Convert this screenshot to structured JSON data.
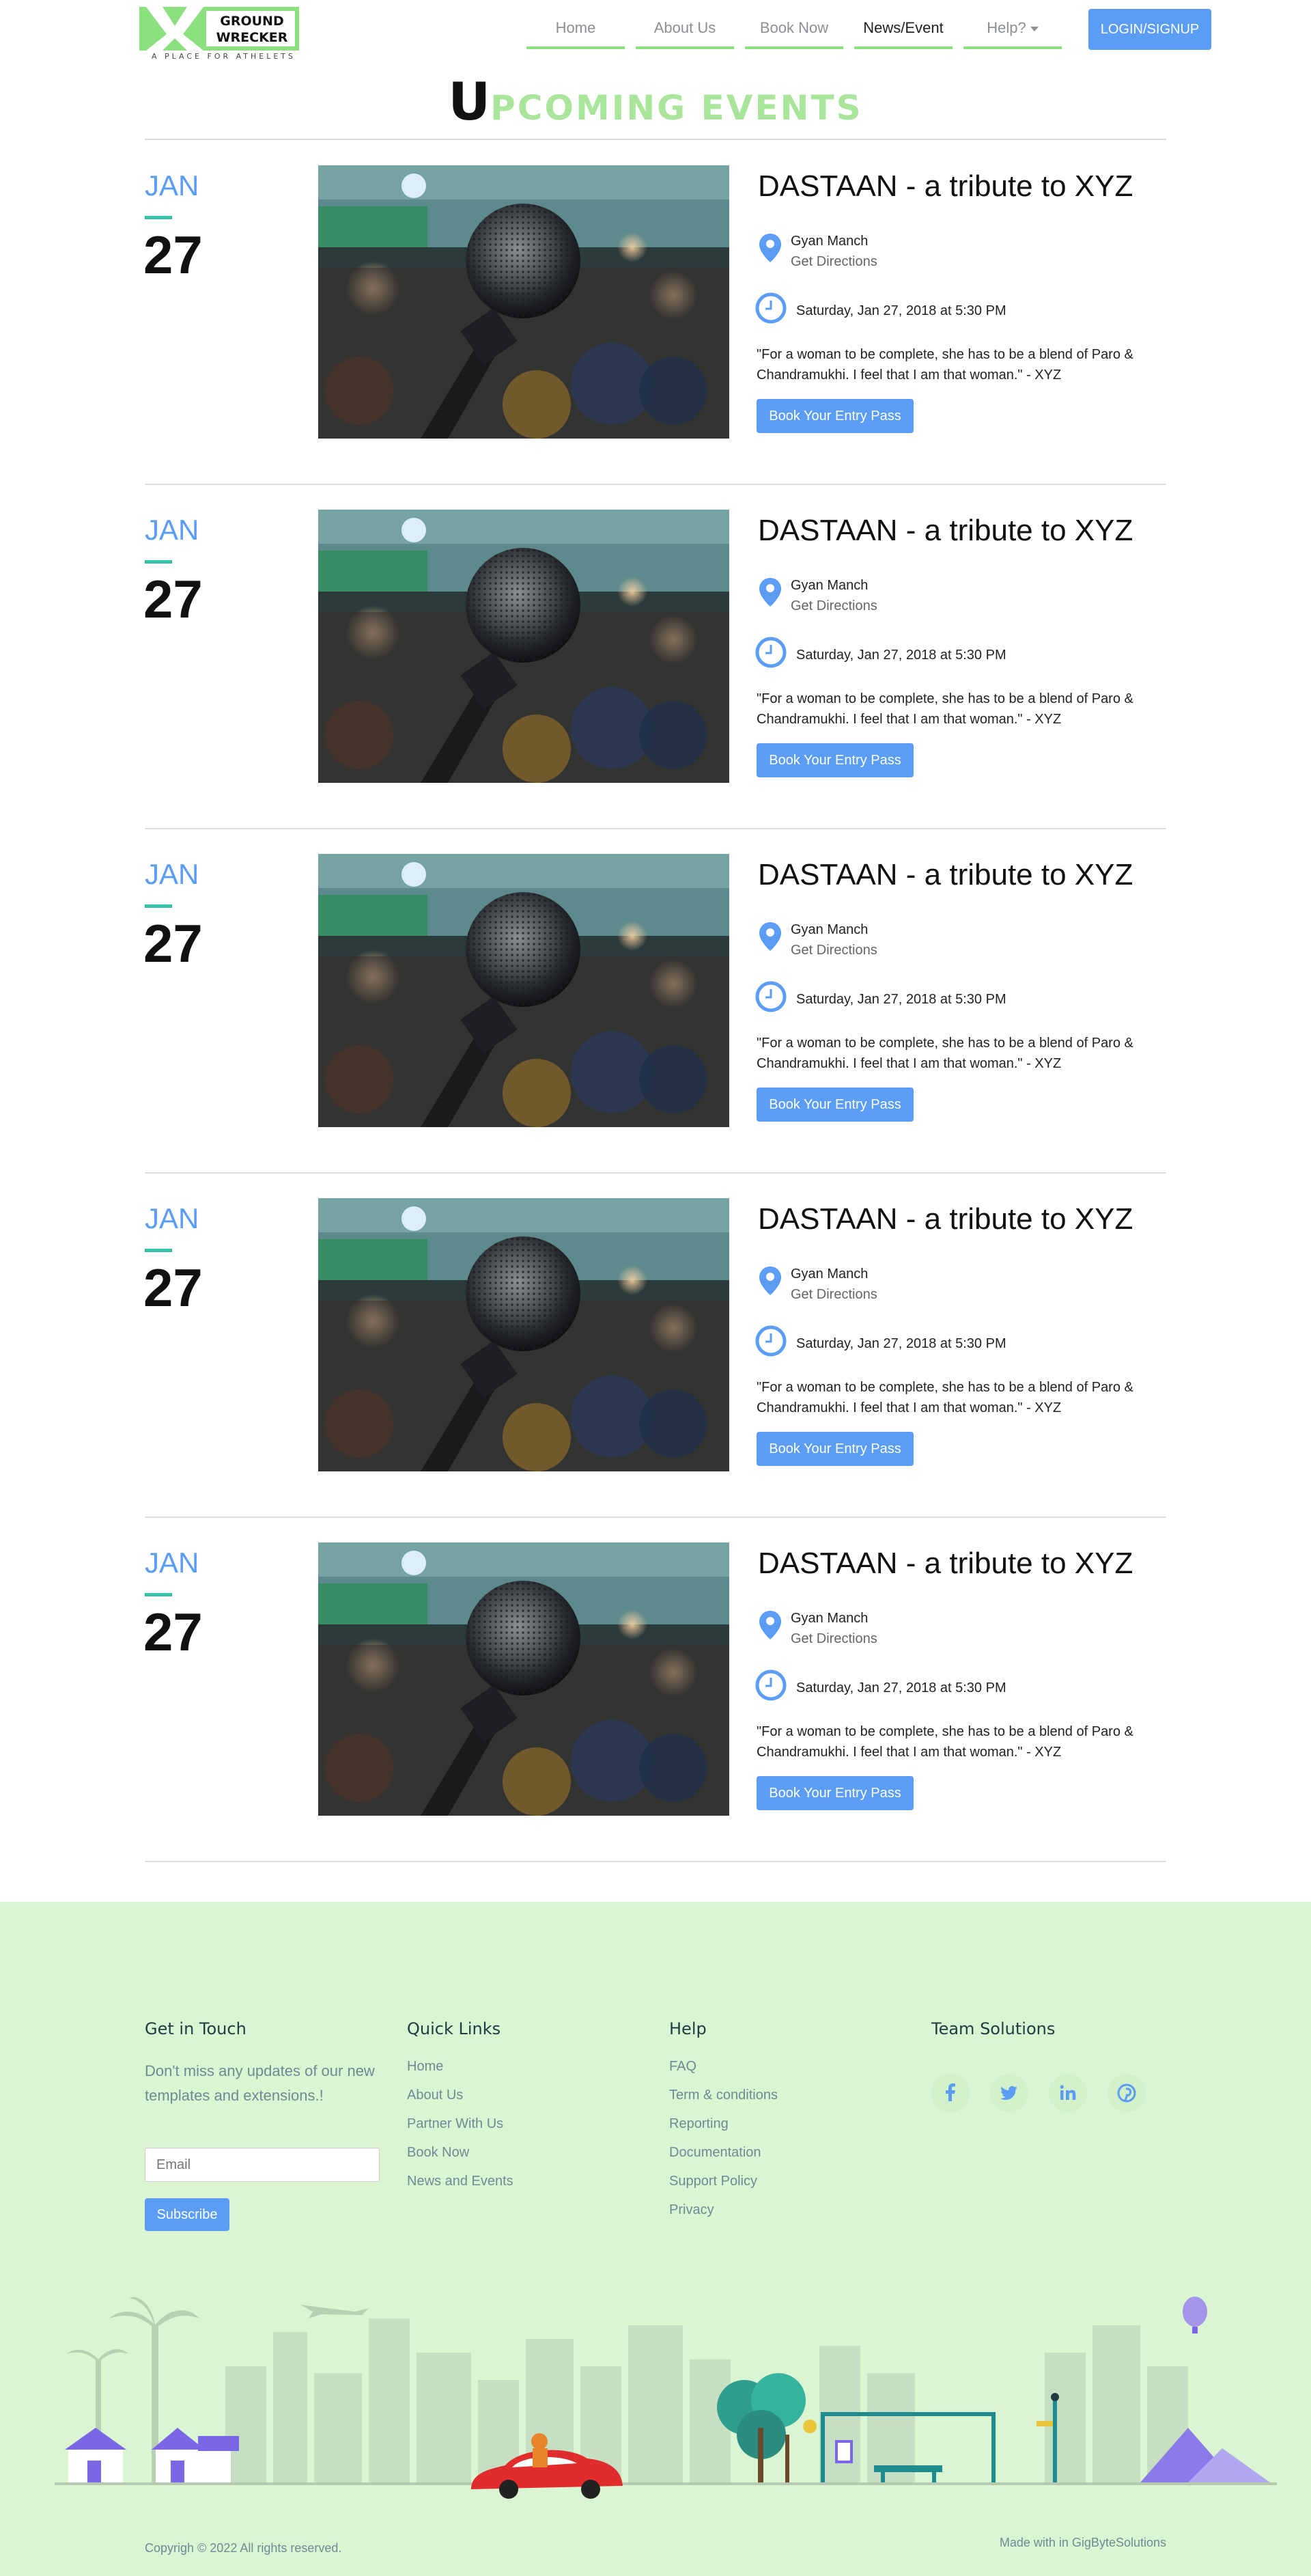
{
  "brand": {
    "line1": "GROUND",
    "line2": "WRECKER",
    "tagline": "A PLACE FOR ATHELETS",
    "accent": "#8ce07f"
  },
  "nav": {
    "items": [
      {
        "label": "Home"
      },
      {
        "label": "About Us"
      },
      {
        "label": "Book Now"
      },
      {
        "label": "News/Event"
      },
      {
        "label": "Help?"
      }
    ],
    "active": "News/Event",
    "login": "LOGIN/SIGNUP"
  },
  "heading": {
    "first": "U",
    "rest": "PCOMING EVENTS"
  },
  "events": [
    {
      "month": "JAN",
      "day": "27",
      "title": "DASTAAN - a tribute to XYZ",
      "venue": "Gyan Manch",
      "directions": "Get Directions",
      "datetime": "Saturday, Jan 27, 2018 at 5:30 PM",
      "quote": "\"For a woman to be complete, she has to be a blend of Paro & Chandramukhi. I feel that I am that woman.\" - XYZ",
      "button": "Book Your Entry Pass"
    },
    {
      "month": "JAN",
      "day": "27",
      "title": "DASTAAN - a tribute to XYZ",
      "venue": "Gyan Manch",
      "directions": "Get Directions",
      "datetime": "Saturday, Jan 27, 2018 at 5:30 PM",
      "quote": "\"For a woman to be complete, she has to be a blend of Paro & Chandramukhi. I feel that I am that woman.\" - XYZ",
      "button": "Book Your Entry Pass"
    },
    {
      "month": "JAN",
      "day": "27",
      "title": "DASTAAN - a tribute to XYZ",
      "venue": "Gyan Manch",
      "directions": "Get Directions",
      "datetime": "Saturday, Jan 27, 2018 at 5:30 PM",
      "quote": "\"For a woman to be complete, she has to be a blend of Paro & Chandramukhi. I feel that I am that woman.\" - XYZ",
      "button": "Book Your Entry Pass"
    },
    {
      "month": "JAN",
      "day": "27",
      "title": "DASTAAN - a tribute to XYZ",
      "venue": "Gyan Manch",
      "directions": "Get Directions",
      "datetime": "Saturday, Jan 27, 2018 at 5:30 PM",
      "quote": "\"For a woman to be complete, she has to be a blend of Paro & Chandramukhi. I feel that I am that woman.\" - XYZ",
      "button": "Book Your Entry Pass"
    },
    {
      "month": "JAN",
      "day": "27",
      "title": "DASTAAN - a tribute to XYZ",
      "venue": "Gyan Manch",
      "directions": "Get Directions",
      "datetime": "Saturday, Jan 27, 2018 at 5:30 PM",
      "quote": "\"For a woman to be complete, she has to be a blend of Paro & Chandramukhi. I feel that I am that woman.\" - XYZ",
      "button": "Book Your Entry Pass"
    }
  ],
  "footer": {
    "get_in_touch": {
      "title": "Get in Touch",
      "text": "Don't miss any updates of our new templates and extensions.!",
      "email_placeholder": "Email",
      "subscribe": "Subscribe"
    },
    "quick_links": {
      "title": "Quick Links",
      "items": [
        "Home",
        "About Us",
        "Partner With Us",
        "Book Now",
        "News and Events"
      ]
    },
    "help": {
      "title": "Help",
      "items": [
        "FAQ",
        "Term & conditions",
        "Reporting",
        "Documentation",
        "Support Policy",
        "Privacy"
      ]
    },
    "team": {
      "title": "Team Solutions",
      "social": [
        "facebook-icon",
        "twitter-icon",
        "linkedin-icon",
        "pinterest-icon"
      ]
    },
    "copyright": "Copyrigh © 2022 All rights reserved.",
    "made_with": "Made with in GigByteSolutions"
  },
  "colors": {
    "primary": "#5b9cf5",
    "footer_bg": "#d9f5d1",
    "teal": "#35c2a9"
  }
}
